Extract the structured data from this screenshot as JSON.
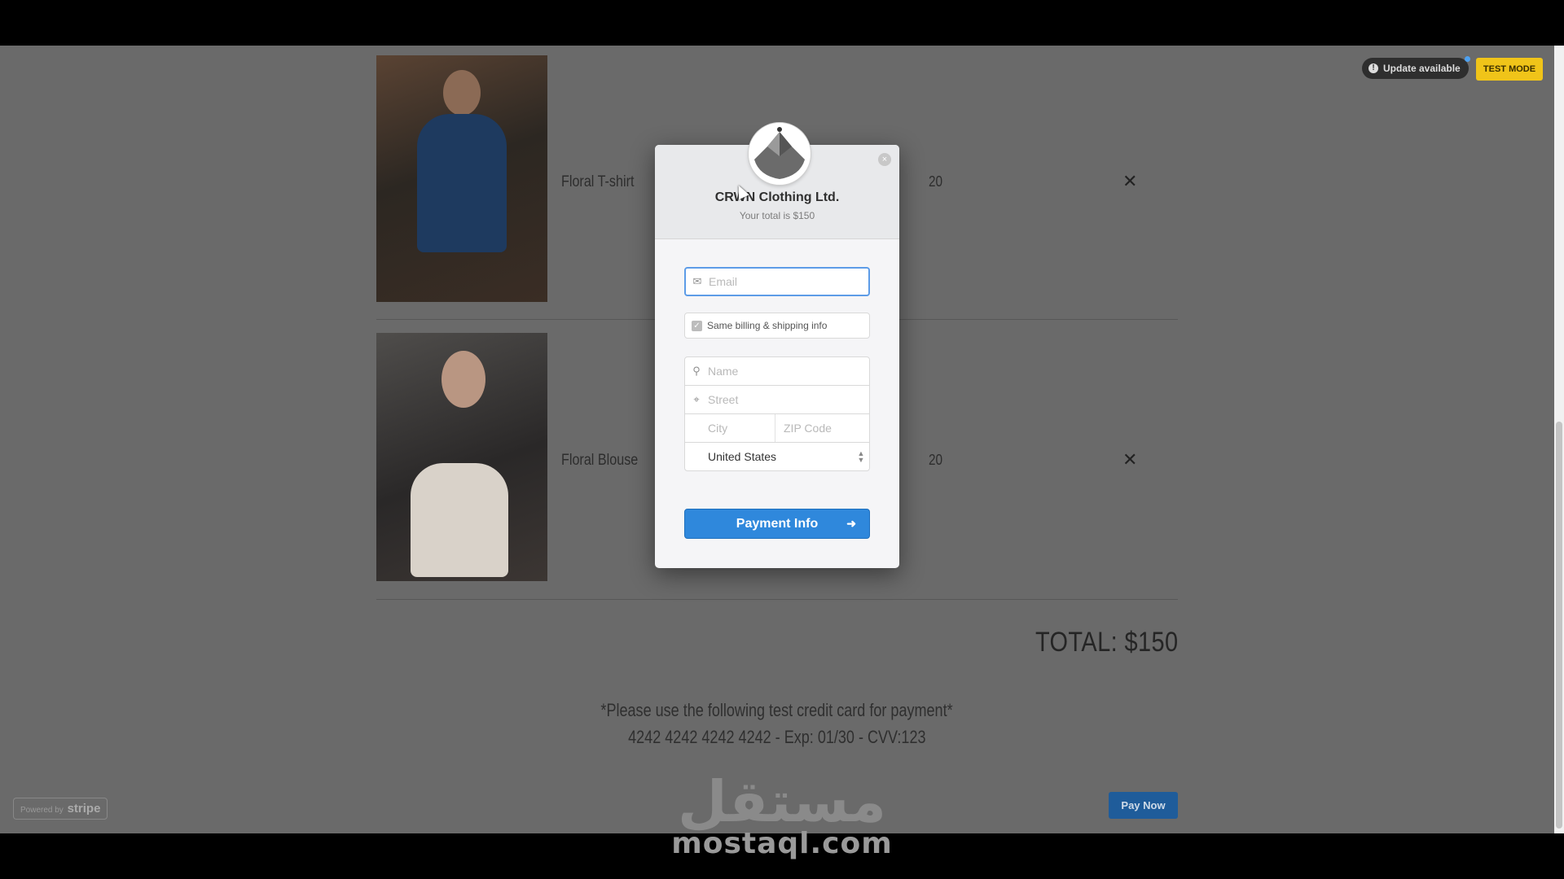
{
  "cart": {
    "items": [
      {
        "name": "Floral T-shirt",
        "quantity": "20",
        "remove": "✕"
      },
      {
        "name": "Floral Blouse",
        "quantity": "20",
        "remove": "✕"
      }
    ],
    "total": "TOTAL: $150",
    "test_note_line1": "*Please use the following test credit card for payment*",
    "test_note_line2": "4242 4242 4242 4242 - Exp: 01/30 - CVV:123",
    "pay_now": "Pay Now"
  },
  "stripe": {
    "powered_by": "Powered by",
    "brand": "stripe",
    "update_available": "Update available",
    "test_mode": "TEST MODE"
  },
  "checkout": {
    "company": "CRWN Clothing Ltd.",
    "subtitle": "Your total is $150",
    "email_placeholder": "Email",
    "same_billing": "Same billing & shipping info",
    "name_placeholder": "Name",
    "street_placeholder": "Street",
    "city_placeholder": "City",
    "zip_placeholder": "ZIP Code",
    "country": "United States",
    "payment_info": "Payment Info",
    "close": "×"
  },
  "watermark": {
    "arabic": "مستقل",
    "latin": "mostaql.com"
  },
  "colors": {
    "accent": "#2f88dc",
    "test_mode": "#f0c419",
    "overlay": "#6a6a6a"
  }
}
